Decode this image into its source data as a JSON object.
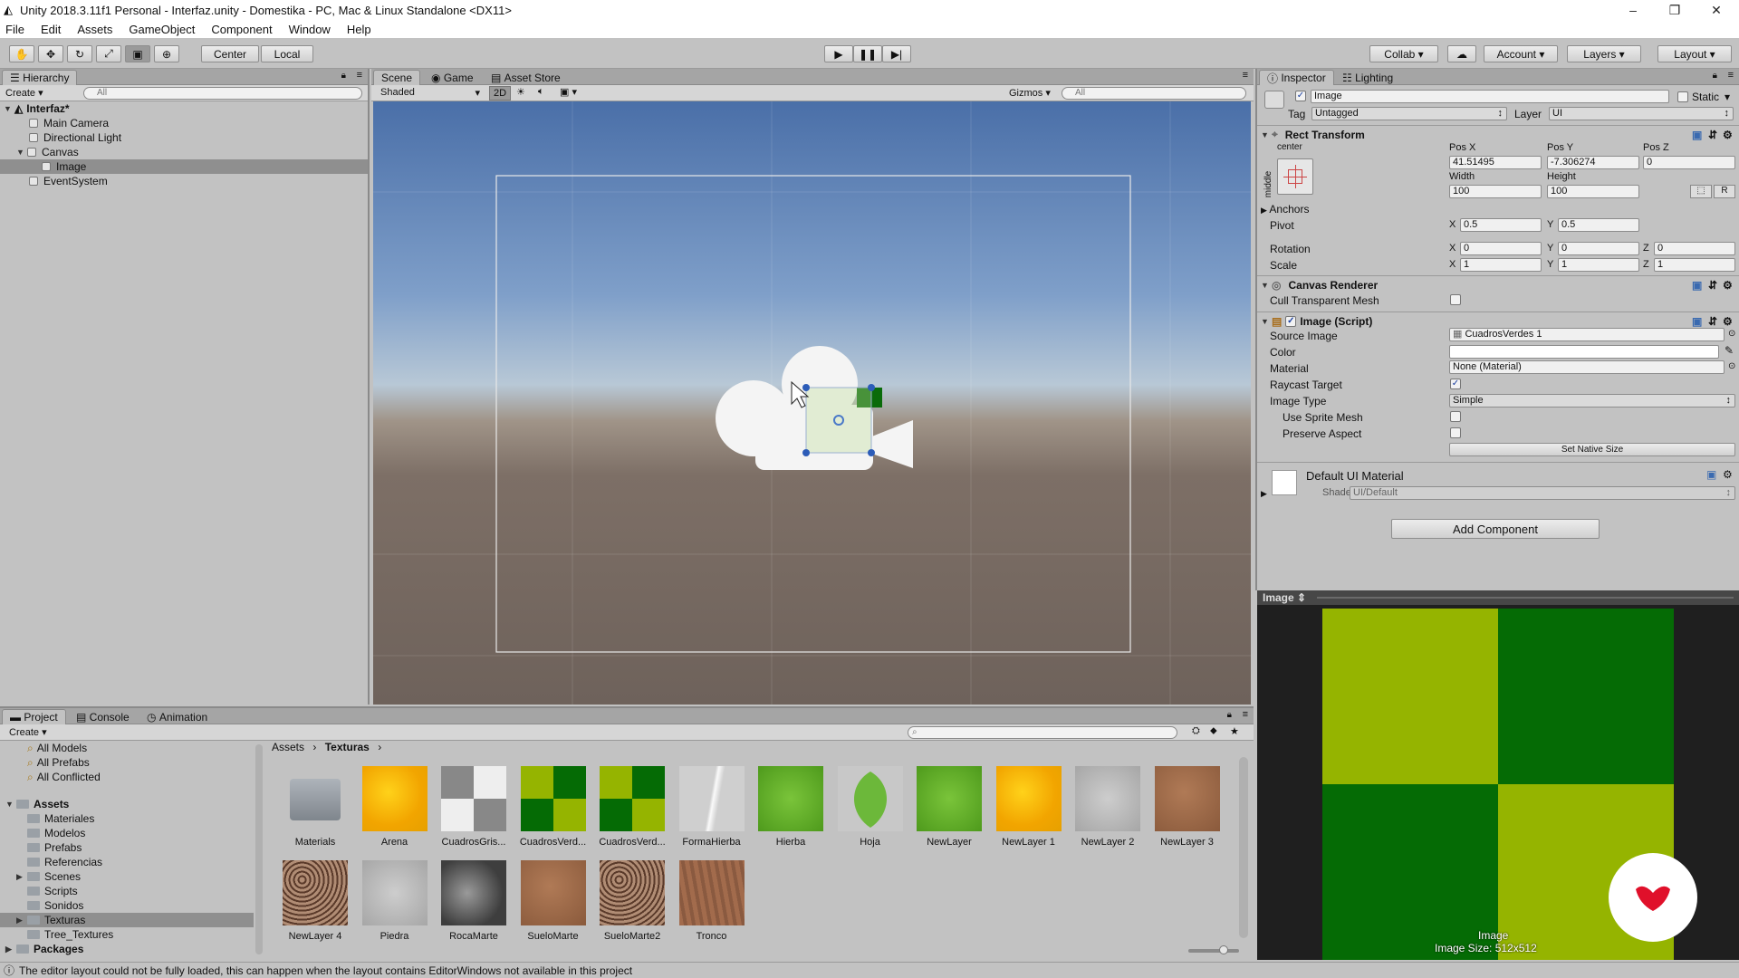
{
  "window": {
    "title": "Unity 2018.3.11f1 Personal - Interfaz.unity - Domestika - PC, Mac & Linux Standalone <DX11>",
    "controls": [
      "–",
      "❐",
      "✕"
    ]
  },
  "menu": [
    "File",
    "Edit",
    "Assets",
    "GameObject",
    "Component",
    "Window",
    "Help"
  ],
  "toolbar": {
    "center_label": "Center",
    "local_label": "Local",
    "collab_label": "Collab",
    "account_label": "Account",
    "layers_label": "Layers",
    "layout_label": "Layout"
  },
  "hierarchy": {
    "tab": "Hierarchy",
    "create": "Create",
    "search_placeholder": "All",
    "scene_name": "Interfaz*",
    "items": [
      "Main Camera",
      "Directional Light",
      "Canvas",
      "Image",
      "EventSystem"
    ]
  },
  "scene": {
    "tabs": [
      "Scene",
      "Game",
      "Asset Store"
    ],
    "shading": "Shaded",
    "mode_2d": "2D",
    "gizmos": "Gizmos",
    "search_placeholder": "All"
  },
  "inspector": {
    "tabs": [
      "Inspector",
      "Lighting"
    ],
    "object_name": "Image",
    "static_label": "Static",
    "tag_label": "Tag",
    "tag_value": "Untagged",
    "layer_label": "Layer",
    "layer_value": "UI",
    "rect_transform": {
      "title": "Rect Transform",
      "anchor_h": "center",
      "anchor_v": "middle",
      "posx_label": "Pos X",
      "posy_label": "Pos Y",
      "posz_label": "Pos Z",
      "posx": "41.51495",
      "posy": "-7.306274",
      "posz": "0",
      "width_label": "Width",
      "height_label": "Height",
      "width": "100",
      "height": "100",
      "anchors": "Anchors",
      "pivot": "Pivot",
      "pivot_x": "0.5",
      "pivot_y": "0.5",
      "rotation": "Rotation",
      "rot_x": "0",
      "rot_y": "0",
      "rot_z": "0",
      "scale": "Scale",
      "scale_x": "1",
      "scale_y": "1",
      "scale_z": "1",
      "r_btn": "R"
    },
    "canvas_renderer": {
      "title": "Canvas Renderer",
      "cull_label": "Cull Transparent Mesh"
    },
    "image_script": {
      "title": "Image (Script)",
      "source_label": "Source Image",
      "source_value": "CuadrosVerdes 1",
      "color_label": "Color",
      "material_label": "Material",
      "material_value": "None (Material)",
      "raycast_label": "Raycast Target",
      "type_label": "Image Type",
      "type_value": "Simple",
      "sprite_mesh_label": "Use Sprite Mesh",
      "preserve_label": "Preserve Aspect",
      "native_btn": "Set Native Size"
    },
    "material": {
      "title": "Default UI Material",
      "shader_label": "Shader",
      "shader_value": "UI/Default"
    },
    "add_component": "Add Component"
  },
  "preview": {
    "title": "Image",
    "caption_name": "Image",
    "caption_size": "Image Size: 512x512",
    "colors": {
      "light": "#95b400",
      "dark": "#056b05"
    }
  },
  "project": {
    "tabs": [
      "Project",
      "Console",
      "Animation"
    ],
    "create": "Create",
    "favorites": [
      "All Models",
      "All Prefabs",
      "All Conflicted"
    ],
    "assets_root": "Assets",
    "folders": [
      "Materiales",
      "Modelos",
      "Prefabs",
      "Referencias",
      "Scenes",
      "Scripts",
      "Sonidos",
      "Texturas",
      "Tree_Textures"
    ],
    "packages": "Packages",
    "breadcrumb": [
      "Assets",
      "Texturas"
    ],
    "assets_row1": [
      {
        "name": "Materials",
        "kind": "folder"
      },
      {
        "name": "Arena",
        "kind": "sand"
      },
      {
        "name": "CuadrosGris...",
        "kind": "graycheck"
      },
      {
        "name": "CuadrosVerd...",
        "kind": "greencheck"
      },
      {
        "name": "CuadrosVerd...",
        "kind": "greencheck"
      },
      {
        "name": "FormaHierba",
        "kind": "blade"
      },
      {
        "name": "Hierba",
        "kind": "grass"
      },
      {
        "name": "Hoja",
        "kind": "leaf"
      },
      {
        "name": "NewLayer",
        "kind": "grass"
      },
      {
        "name": "NewLayer 1",
        "kind": "sand"
      },
      {
        "name": "NewLayer 2",
        "kind": "concrete"
      },
      {
        "name": "NewLayer 3",
        "kind": "dirt"
      }
    ],
    "assets_row2": [
      {
        "name": "NewLayer 4",
        "kind": "rocky"
      },
      {
        "name": "Piedra",
        "kind": "concrete"
      },
      {
        "name": "RocaMarte",
        "kind": "marble"
      },
      {
        "name": "SueloMarte",
        "kind": "dirt"
      },
      {
        "name": "SueloMarte2",
        "kind": "rocky"
      },
      {
        "name": "Tronco",
        "kind": "bark"
      }
    ]
  },
  "status": "The editor layout could not be fully loaded, this can happen when the layout contains EditorWindows not available in this project"
}
